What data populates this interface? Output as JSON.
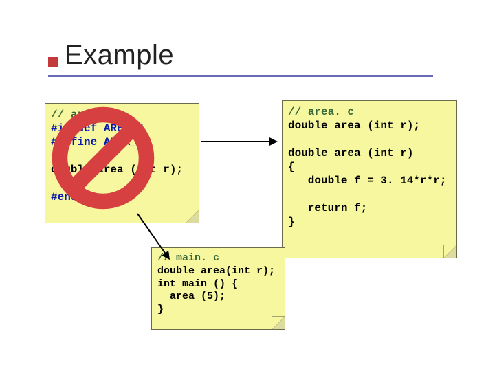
{
  "slide": {
    "title": "Example"
  },
  "header_box": {
    "line1": "// area. h",
    "line2": "#ifndef AREA_H",
    "line3": "#define AREA_H",
    "line4": "",
    "line5": "double area (int r);",
    "line6": "",
    "line7": "#endif"
  },
  "areac_box": {
    "line1": "// area. c",
    "line2": "double area (int r);",
    "line3": "",
    "line4": "double area (int r)",
    "line5": "{",
    "line6": "   double f = 3. 14*r*r;",
    "line7": "",
    "line8": "   return f;",
    "line9": "}"
  },
  "main_box": {
    "line1": "// main. c",
    "line2": "double area(int r);",
    "line3": "int main () {",
    "line4": "  area (5);",
    "line5": "}"
  }
}
